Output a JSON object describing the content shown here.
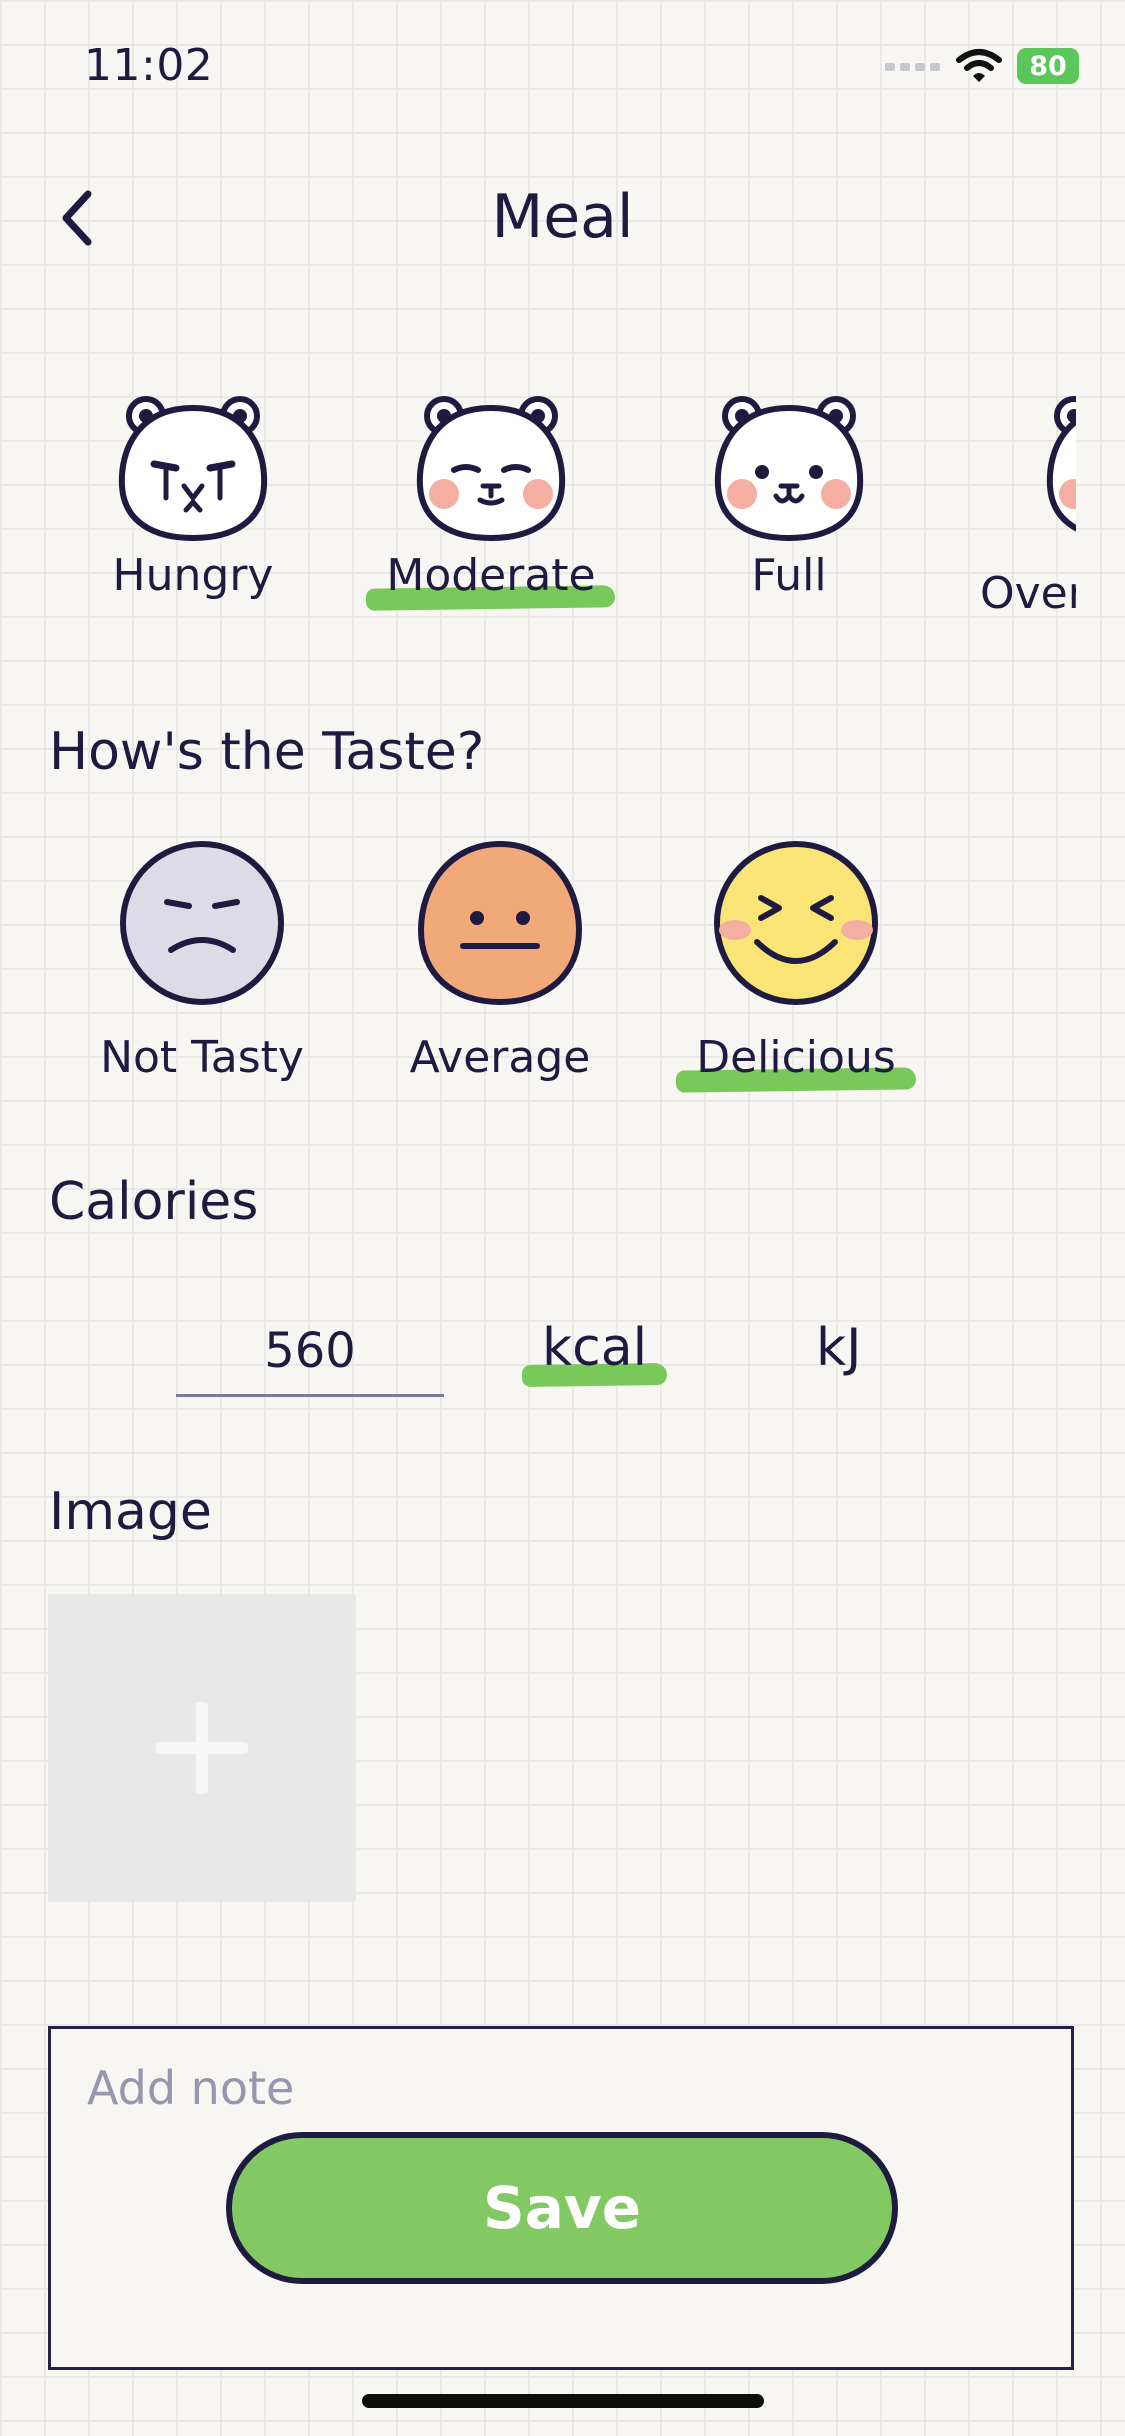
{
  "status": {
    "time": "11:02",
    "battery": "80"
  },
  "nav": {
    "title": "Meal",
    "back_icon": "chevron-left-icon"
  },
  "fullness": {
    "options": [
      {
        "label": "Hungry",
        "icon": "bear-hungry-icon"
      },
      {
        "label": "Moderate",
        "icon": "bear-moderate-icon"
      },
      {
        "label": "Full",
        "icon": "bear-full-icon"
      },
      {
        "label": "Over",
        "icon": "bear-over-icon"
      }
    ],
    "selected": "Moderate"
  },
  "taste": {
    "title": "How's the Taste?",
    "options": [
      {
        "label": "Not Tasty",
        "color": "#dddbe6"
      },
      {
        "label": "Average",
        "color": "#f2a97a"
      },
      {
        "label": "Delicious",
        "color": "#fbe476"
      }
    ],
    "selected": "Delicious"
  },
  "calories": {
    "title": "Calories",
    "value": "560",
    "units": [
      "kcal",
      "kJ"
    ],
    "selected_unit": "kcal"
  },
  "image": {
    "title": "Image",
    "add_icon": "plus-icon"
  },
  "note": {
    "placeholder": "Add note"
  },
  "save": {
    "label": "Save"
  },
  "colors": {
    "accent": "#82c964",
    "highlight": "#78c85a",
    "ink": "#1e1a40",
    "blush": "#f4aea2"
  }
}
